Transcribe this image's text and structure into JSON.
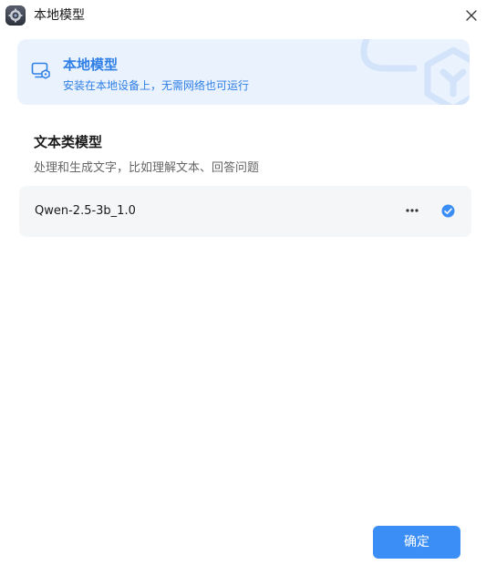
{
  "window": {
    "title": "本地模型"
  },
  "banner": {
    "title": "本地模型",
    "subtitle": "安装在本地设备上，无需网络也可运行",
    "icon": "local-device-icon"
  },
  "section": {
    "title": "文本类模型",
    "description": "处理和生成文字，比如理解文本、回答问题"
  },
  "models": [
    {
      "name": "Qwen-2.5-3b_1.0",
      "selected": true
    }
  ],
  "footer": {
    "confirm_label": "确定"
  },
  "colors": {
    "accent": "#3a8ef5",
    "banner_bg": "#e9f2fd",
    "banner_text": "#2f7fe6",
    "item_bg": "#f5f6f7"
  }
}
